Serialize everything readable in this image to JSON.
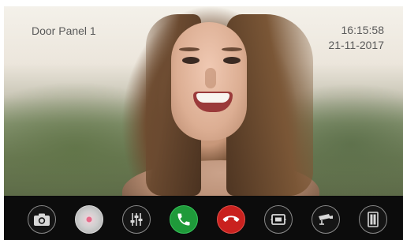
{
  "overlay": {
    "panel_name": "Door Panel 1",
    "time": "16:15:58",
    "date": "21-11-2017"
  },
  "toolbar": {
    "buttons": [
      {
        "id": "snapshot",
        "icon": "camera-icon"
      },
      {
        "id": "microphone",
        "icon": "microphone-icon"
      },
      {
        "id": "settings",
        "icon": "sliders-icon"
      },
      {
        "id": "answer",
        "icon": "phone-answer-icon",
        "color": "#1f9a3a"
      },
      {
        "id": "hangup",
        "icon": "phone-hangup-icon",
        "color": "#c9211e"
      },
      {
        "id": "monitor",
        "icon": "monitor-icon"
      },
      {
        "id": "cctv",
        "icon": "cctv-camera-icon"
      },
      {
        "id": "door",
        "icon": "door-icon"
      }
    ]
  },
  "colors": {
    "toolbar_bg": "#0c0c0c",
    "answer": "#1f9a3a",
    "hangup": "#c9211e",
    "overlay_text": "#5a5a5a"
  }
}
